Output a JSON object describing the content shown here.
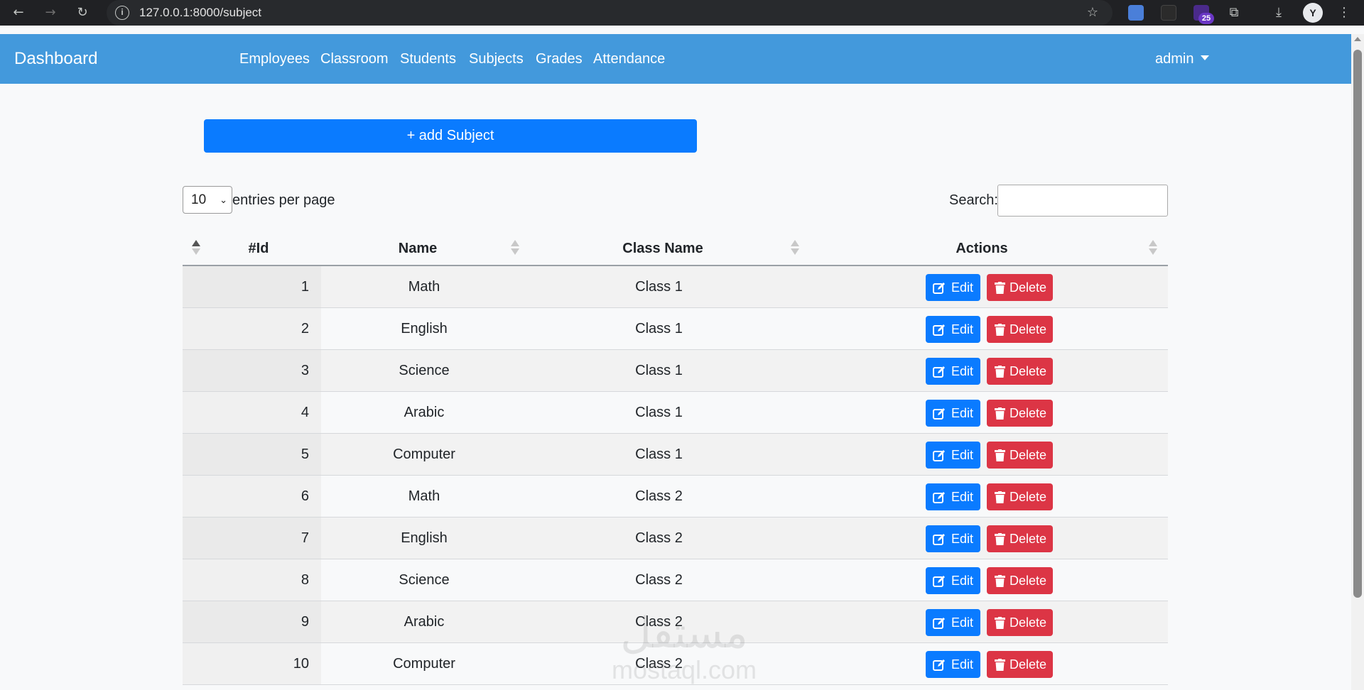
{
  "browser": {
    "url": "127.0.0.1:8000/subject",
    "extension_badge": "25",
    "profile_initial": "Y"
  },
  "navbar": {
    "brand": "Dashboard",
    "links": [
      "Employees",
      "Classroom",
      "Students",
      "Subjects",
      "Grades",
      "Attendance"
    ],
    "user": "admin",
    "color": "#4399dc"
  },
  "toolbar": {
    "add_label": "+ add Subject",
    "entries_value": "10",
    "entries_label": "entries per page",
    "search_label": "Search:",
    "search_value": ""
  },
  "table": {
    "columns": [
      "#Id",
      "Name",
      "Class Name",
      "Actions"
    ],
    "edit_label": "Edit",
    "delete_label": "Delete",
    "rows": [
      {
        "id": "1",
        "name": "Math",
        "class_name": "Class 1"
      },
      {
        "id": "2",
        "name": "English",
        "class_name": "Class 1"
      },
      {
        "id": "3",
        "name": "Science",
        "class_name": "Class 1"
      },
      {
        "id": "4",
        "name": "Arabic",
        "class_name": "Class 1"
      },
      {
        "id": "5",
        "name": "Computer",
        "class_name": "Class 1"
      },
      {
        "id": "6",
        "name": "Math",
        "class_name": "Class 2"
      },
      {
        "id": "7",
        "name": "English",
        "class_name": "Class 2"
      },
      {
        "id": "8",
        "name": "Science",
        "class_name": "Class 2"
      },
      {
        "id": "9",
        "name": "Arabic",
        "class_name": "Class 2"
      },
      {
        "id": "10",
        "name": "Computer",
        "class_name": "Class 2"
      }
    ]
  },
  "watermark": {
    "arabic": "مستقل",
    "latin": "mostaql.com"
  },
  "colors": {
    "primary": "#0a7bff",
    "danger": "#dc3545"
  }
}
